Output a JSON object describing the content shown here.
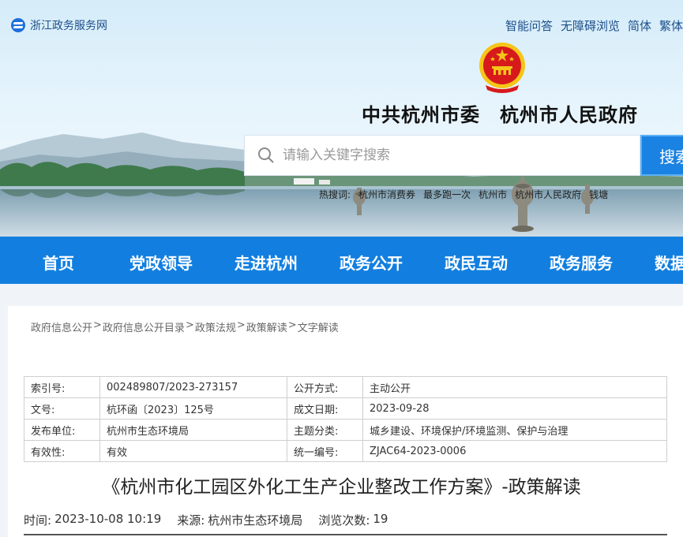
{
  "header": {
    "site_name": "浙江政务服务网",
    "links": [
      "智能问答",
      "无障碍浏览",
      "简体",
      "繁体"
    ],
    "title": "中共杭州市委　杭州市人民政府",
    "search": {
      "placeholder": "请输入关键字搜索",
      "button_label": "搜索"
    },
    "hot_words_label": "热搜词:",
    "hot_words": [
      "杭州市消费券",
      "最多跑一次",
      "杭州市",
      "杭州市人民政府",
      "钱塘"
    ]
  },
  "nav": {
    "items": [
      "首页",
      "党政领导",
      "走进杭州",
      "政务公开",
      "政民互动",
      "政务服务",
      "数据"
    ]
  },
  "breadcrumb": {
    "items": [
      "政府信息公开",
      "政府信息公开目录",
      "政策法规",
      "政策解读",
      "文字解读"
    ],
    "separator": ">"
  },
  "meta": {
    "rows": [
      {
        "k1": "索引号:",
        "v1": "002489807/2023-273157",
        "k2": "公开方式:",
        "v2": "主动公开"
      },
      {
        "k1": "文号:",
        "v1": "杭环函〔2023〕125号",
        "k2": "成文日期:",
        "v2": "2023-09-28"
      },
      {
        "k1": "发布单位:",
        "v1": "杭州市生态环境局",
        "k2": "主题分类:",
        "v2": "城乡建设、环境保护/环境监测、保护与治理"
      },
      {
        "k1": "有效性:",
        "v1": "有效",
        "k2": "统一编号:",
        "v2": "ZJAC64-2023-0006"
      }
    ]
  },
  "article": {
    "title": "《杭州市化工园区外化工生产企业整改工作方案》-政策解读",
    "time_label": "时间:",
    "time_value": "2023-10-08 10:19",
    "source_label": "来源:",
    "source_value": "杭州市生态环境局",
    "views_label": "浏览次数:",
    "views_value": "19"
  },
  "colors": {
    "nav_bg": "#127fe0",
    "search_button": "#1a82e2",
    "emblem_red": "#d7191c",
    "emblem_gold": "#f5c518"
  }
}
